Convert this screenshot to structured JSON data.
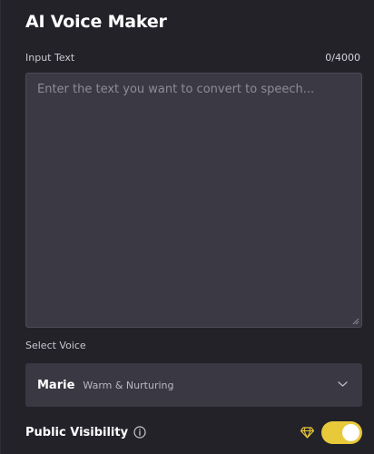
{
  "header": {
    "title": "AI Voice Maker"
  },
  "input": {
    "label": "Input Text",
    "counter": "0/4000",
    "value": "",
    "placeholder": "Enter the text you want to convert to speech..."
  },
  "voice": {
    "label": "Select Voice",
    "selected_name": "Marie",
    "selected_description": "Warm & Nurturing"
  },
  "visibility": {
    "label": "Public Visibility",
    "enabled": true,
    "premium_icon": "diamond-icon",
    "info_icon": "info-icon"
  },
  "colors": {
    "background": "#232229",
    "field": "#3a3944",
    "accent": "#e8c93a"
  }
}
